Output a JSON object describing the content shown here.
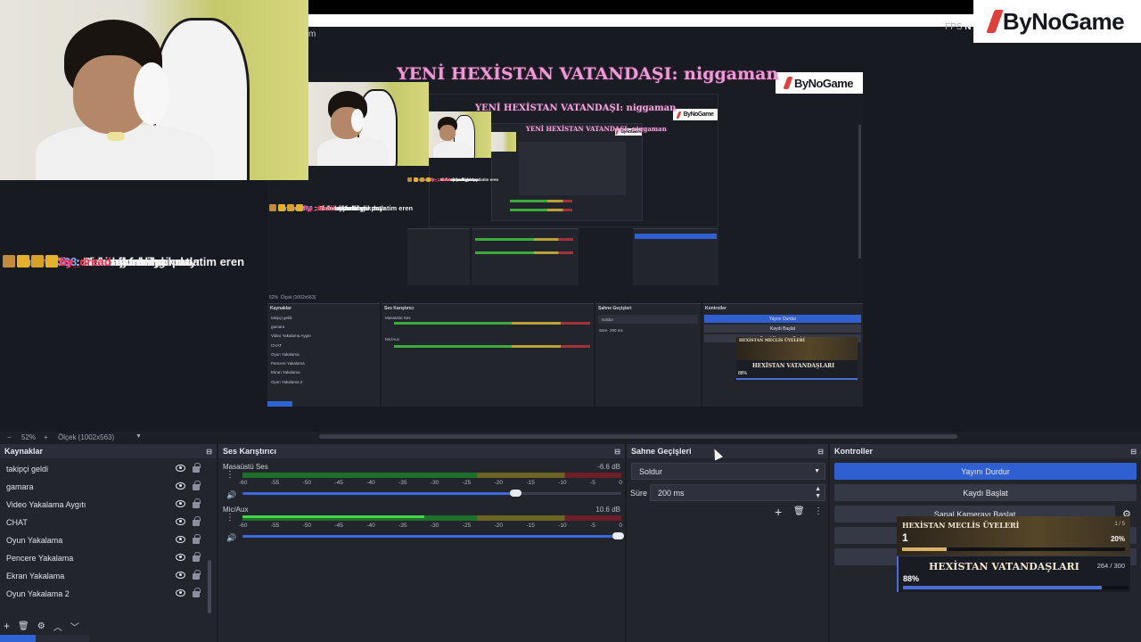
{
  "stream": {
    "fps_label": "FPS",
    "fps_value": "N",
    "cut_text": "m",
    "brand": "ByNoGame",
    "banner": "YENİ HEXİSTAN VATANDAŞI: niggaman"
  },
  "chat": [
    {
      "user": "Emales333",
      "color": "#7fb0ff",
      "badges": [
        "#3a7cf0"
      ],
      "message": ": resident evil gir dayı"
    },
    {
      "user": "smuffiy",
      "color": "#ff69b4",
      "badges": [
        "#3a7cf0",
        "#e3b12a"
      ],
      "message": ": akdmajkfmshd"
    },
    {
      "user": "by_dread",
      "color": "#ff2a4a",
      "badges": [
        "#c28a3a",
        "#e3b12a",
        "#d7a126",
        "#e3b12a"
      ],
      "message": ": ya karını patlatim eren"
    },
    {
      "user": "smuffiy",
      "color": "#ff69b4",
      "badges": [
        "#3a7cf0",
        "#e3b12a"
      ],
      "message": ": Bi banlamak yokmu"
    },
    {
      "user": "by_dread",
      "color": "#ff2a4a",
      "badges": [
        "#c28a3a",
        "#e3b12a",
        "#d7a126",
        "#e3b12a"
      ],
      "message": ": harbi ya"
    }
  ],
  "overlay": {
    "council_title": "HEXİSTAN MECLİS ÜYELERİ",
    "council_count": "1 / 5",
    "council_value": "1",
    "council_percent": "20%",
    "council_fill": 0.2,
    "citizens_title": "HEXİSTAN VATANDAŞLARI",
    "citizens_count": "264 / 300",
    "citizens_percent": "88%",
    "citizens_fill": 0.88
  },
  "zoom": {
    "minus": "−",
    "value": "52%",
    "plus": "+",
    "scale_label": "Ölçek (1002x563)"
  },
  "sources": {
    "title": "Kaynaklar",
    "items": [
      "takipçi geldi",
      "gamara",
      "Video Yakalama Aygıtı",
      "CHAT",
      "Oyun Yakalama",
      "Pencere Yakalama",
      "Ekran Yakalama",
      "Oyun Yakalama 2"
    ]
  },
  "mixer": {
    "title": "Ses Karıştırıcı",
    "scale": [
      "-60",
      "-55",
      "-50",
      "-45",
      "-40",
      "-35",
      "-30",
      "-25",
      "-20",
      "-15",
      "-10",
      "-5",
      "0"
    ],
    "channels": [
      {
        "name": "Masaüstü Ses",
        "db": "-6.6 dB",
        "level": 0.0,
        "volume": 0.73
      },
      {
        "name": "Mic/Aux",
        "db": "10.6 dB",
        "level": 0.48,
        "volume": 1.0
      }
    ]
  },
  "transitions": {
    "title": "Sahne Geçişleri",
    "selected": "Soldur",
    "duration_label": "Süre",
    "duration_value": "200 ms"
  },
  "controls": {
    "title": "Kontroller",
    "stop_stream": "Yayını Durdur",
    "start_record": "Kaydı Başlat",
    "virtual_cam": "Sanal Kamerayı Başlat",
    "accent": "#2f5fd0"
  },
  "nested": {
    "sources_title": "Kaynaklar",
    "mixer_title": "Ses Karıştırıcı",
    "trans_title": "Sahne Geçişleri",
    "controls_title": "Kontroller",
    "mixer_channel_1": "Masaüstü Ses",
    "mixer_channel_2": "Mic/Aux",
    "trans_selected": "Soldur",
    "trans_duration_label": "Süre",
    "trans_duration": "200 ms",
    "stop_stream": "Yayını Durdur",
    "start_record": "Kaydı Başlat",
    "virtual_cam": "Sanal Kamerayı Başlat",
    "zoom": "52%",
    "scale_label": "Ölçek (1002x563)"
  }
}
